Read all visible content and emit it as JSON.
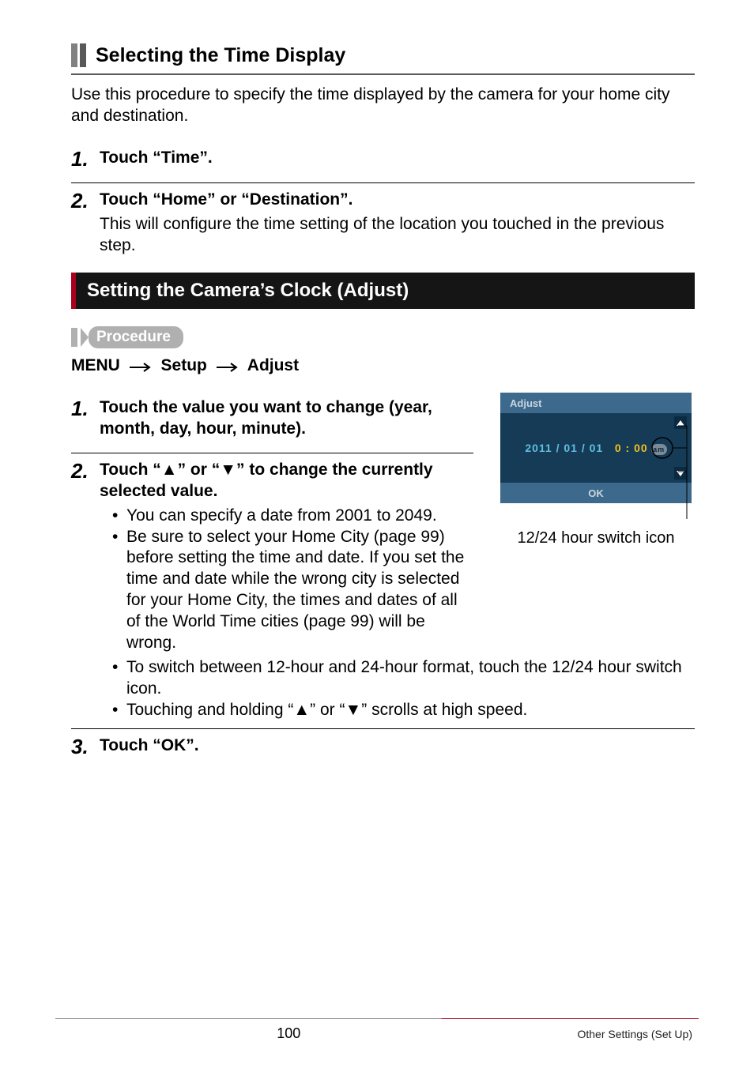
{
  "heading2": "Selecting the Time Display",
  "intro": "Use this procedure to specify the time displayed by the camera for your home city and destination.",
  "stepsA": {
    "s1": {
      "num": "1.",
      "title": "Touch “Time”."
    },
    "s2": {
      "num": "2.",
      "title": "Touch “Home” or “Destination”.",
      "body": "This will configure the time setting of the location you touched in the previous step."
    }
  },
  "sectionTitle": "Setting the Camera’s Clock (Adjust)",
  "procedureLabel": "Procedure",
  "procPath": {
    "p1": "MENU",
    "p2": "Setup",
    "p3": "Adjust"
  },
  "stepsB": {
    "s1": {
      "num": "1.",
      "title": "Touch the value you want to change (year, month, day, hour, minute)."
    },
    "s2": {
      "num": "2.",
      "titleA": "Touch “",
      "titleB": "” or “",
      "titleC": "” to change the currently selected value.",
      "b1": "You can specify a date from 2001 to 2049.",
      "b2": "Be sure to select your Home City (page 99) before setting the time and date. If you set the time and date while the wrong city is selected for your Home City, the times and dates of all of the World Time cities (page 99) will be wrong.",
      "b3": "To switch between 12-hour and 24-hour format, touch the 12/24 hour switch icon.",
      "b4a": "Touching and holding “",
      "b4b": "” or “",
      "b4c": "” scrolls at high speed."
    },
    "s3": {
      "num": "3.",
      "title": "Touch “OK”."
    }
  },
  "screenshot": {
    "title": "Adjust",
    "date": "2011 / 01 / 01",
    "time": "0 : 00",
    "ampm": "am",
    "ok": "OK"
  },
  "calloutText": "12/24 hour switch icon",
  "footer": {
    "page": "100",
    "section": "Other Settings (Set Up)"
  }
}
